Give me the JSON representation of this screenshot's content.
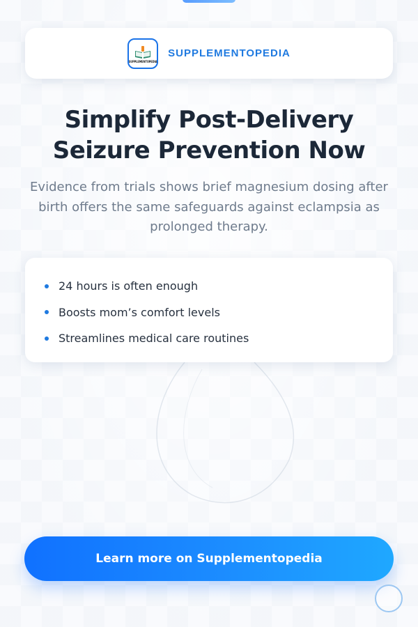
{
  "header": {
    "logo_text": "SUPPLEMENTOPEDIA",
    "brand_name": "SUPPLEMENTOPEDIA"
  },
  "hero": {
    "headline": "Simplify Post-Delivery Seizure Prevention Now",
    "subtext": "Evidence from trials shows brief magnesium dosing after birth offers the same safeguards against eclampsia as prolonged therapy."
  },
  "benefits": [
    "24 hours is often enough",
    "Boosts mom’s comfort levels",
    "Streamlines medical care routines"
  ],
  "cta": {
    "label": "Learn more on Supplementopedia"
  },
  "colors": {
    "accent": "#1f7ae0",
    "cta_start": "#1071ff",
    "cta_end": "#1fa8ff",
    "headline": "#1c2838"
  }
}
